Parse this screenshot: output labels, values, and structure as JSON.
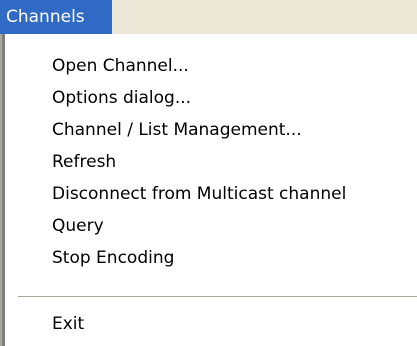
{
  "menubar": {
    "title": "Channels"
  },
  "menu": {
    "items": [
      {
        "label": "Open Channel..."
      },
      {
        "label": "Options dialog..."
      },
      {
        "label": "Channel / List Management..."
      },
      {
        "label": "Refresh"
      },
      {
        "label": "Disconnect from Multicast channel"
      },
      {
        "label": "Query"
      },
      {
        "label": "Stop Encoding"
      },
      {
        "label": "Exit"
      }
    ]
  },
  "colors": {
    "highlight": "#316ac5",
    "menubar_bg": "#ece9d8",
    "menu_bg": "#ffffff",
    "separator": "#aca899"
  }
}
